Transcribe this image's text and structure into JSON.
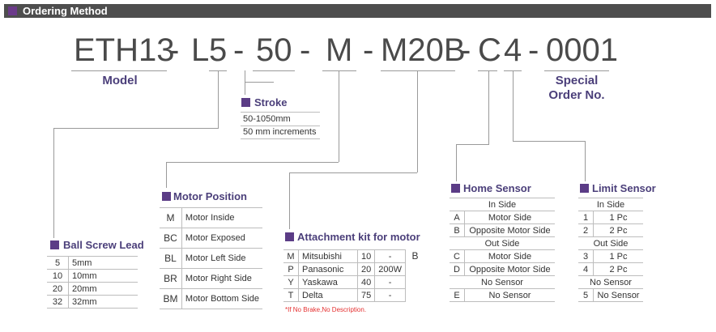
{
  "header": {
    "title": "Ordering Method"
  },
  "code": {
    "parts": [
      "ETH13",
      "-",
      "L",
      "5",
      "-",
      "50",
      "-",
      "M",
      "-",
      "M20B",
      "-",
      "C",
      "4",
      "-",
      "0001"
    ]
  },
  "labels": {
    "model": "Model",
    "special_line1": "Special",
    "special_line2": "Order No."
  },
  "stroke": {
    "title": "Stroke",
    "rows": [
      "50-1050mm",
      "50 mm increments"
    ]
  },
  "ball_screw_lead": {
    "title": "Ball Screw Lead",
    "rows": [
      {
        "code": "5",
        "value": "5mm"
      },
      {
        "code": "10",
        "value": "10mm"
      },
      {
        "code": "20",
        "value": "20mm"
      },
      {
        "code": "32",
        "value": "32mm"
      }
    ]
  },
  "motor_position": {
    "title": "Motor Position",
    "rows": [
      {
        "code": "M",
        "value": "Motor Inside"
      },
      {
        "code": "BC",
        "value": "Motor Exposed"
      },
      {
        "code": "BL",
        "value": "Motor Left Side"
      },
      {
        "code": "BR",
        "value": "Motor Right Side"
      },
      {
        "code": "BM",
        "value": "Motor Bottom Side"
      }
    ]
  },
  "attachment_kit": {
    "title": "Attachment kit for motor",
    "brake_header": "B",
    "rows": [
      {
        "code": "M",
        "brand": "Mitsubishi",
        "size": "10",
        "watt": "-"
      },
      {
        "code": "P",
        "brand": "Panasonic",
        "size": "20",
        "watt": "200W"
      },
      {
        "code": "Y",
        "brand": "Yaskawa",
        "size": "40",
        "watt": "-"
      },
      {
        "code": "T",
        "brand": "Delta",
        "size": "75",
        "watt": "-"
      }
    ],
    "note": "*If No Brake,No Description."
  },
  "home_sensor": {
    "title": "Home Sensor",
    "in_side": "In Side",
    "out_side": "Out Side",
    "no_sensor": "No Sensor",
    "in_rows": [
      {
        "code": "A",
        "value": "Motor Side"
      },
      {
        "code": "B",
        "value": "Opposite Motor Side"
      }
    ],
    "out_rows": [
      {
        "code": "C",
        "value": "Motor Side"
      },
      {
        "code": "D",
        "value": "Opposite Motor Side"
      }
    ],
    "none_rows": [
      {
        "code": "E",
        "value": "No Sensor"
      }
    ]
  },
  "limit_sensor": {
    "title": "Limit Sensor",
    "in_side": "In Side",
    "out_side": "Out Side",
    "no_sensor": "No Sensor",
    "in_rows": [
      {
        "code": "1",
        "value": "1 Pc"
      },
      {
        "code": "2",
        "value": "2 Pc"
      }
    ],
    "out_rows": [
      {
        "code": "3",
        "value": "1 Pc"
      },
      {
        "code": "4",
        "value": "2 Pc"
      }
    ],
    "none_rows": [
      {
        "code": "5",
        "value": "No Sensor"
      }
    ]
  },
  "colors": {
    "accent": "#5b3c86",
    "header_bg": "#4e4e4e",
    "label": "#4b3f7a",
    "note": "#e53030"
  }
}
